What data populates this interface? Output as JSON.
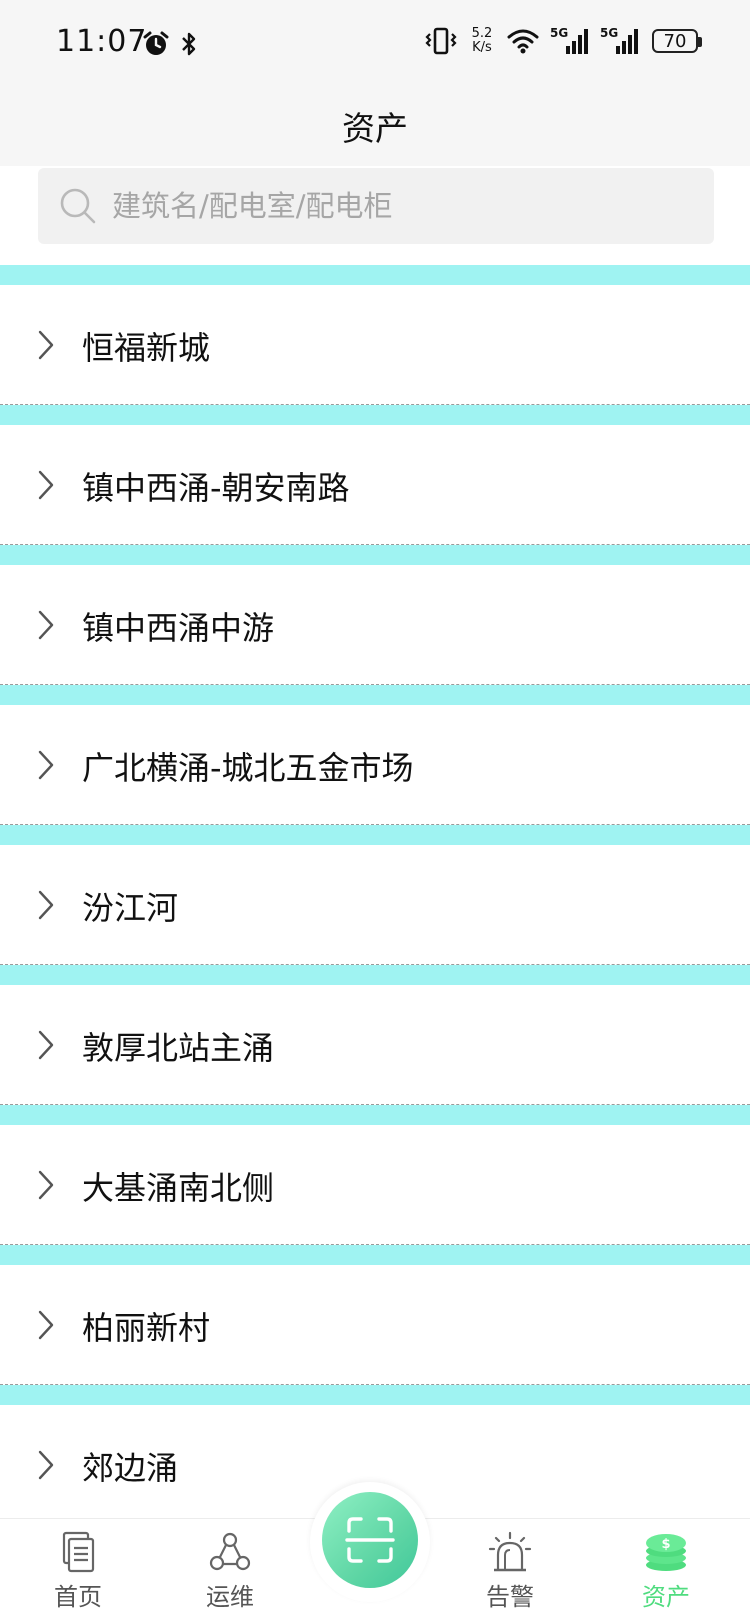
{
  "status_bar": {
    "time": "11:07",
    "net_speed_value": "5.2",
    "net_speed_unit": "K/s",
    "signal1_label": "5G",
    "signal2_label": "5G",
    "battery": "70"
  },
  "header": {
    "title": "资产"
  },
  "search": {
    "placeholder": "建筑名/配电室/配电柜"
  },
  "list": {
    "items": [
      {
        "label": "恒福新城"
      },
      {
        "label": "镇中西涌-朝安南路"
      },
      {
        "label": "镇中西涌中游"
      },
      {
        "label": "广北横涌-城北五金市场"
      },
      {
        "label": "汾江河"
      },
      {
        "label": "敦厚北站主涌"
      },
      {
        "label": "大基涌南北侧"
      },
      {
        "label": "柏丽新村"
      },
      {
        "label": "郊边涌"
      }
    ]
  },
  "bottom_nav": {
    "home": "首页",
    "ops": "运维",
    "alarm": "告警",
    "assets": "资产"
  },
  "colors": {
    "accent": "#4fdc7f",
    "separator": "#9ff3f2",
    "scan_button": "#5fd6a5"
  }
}
